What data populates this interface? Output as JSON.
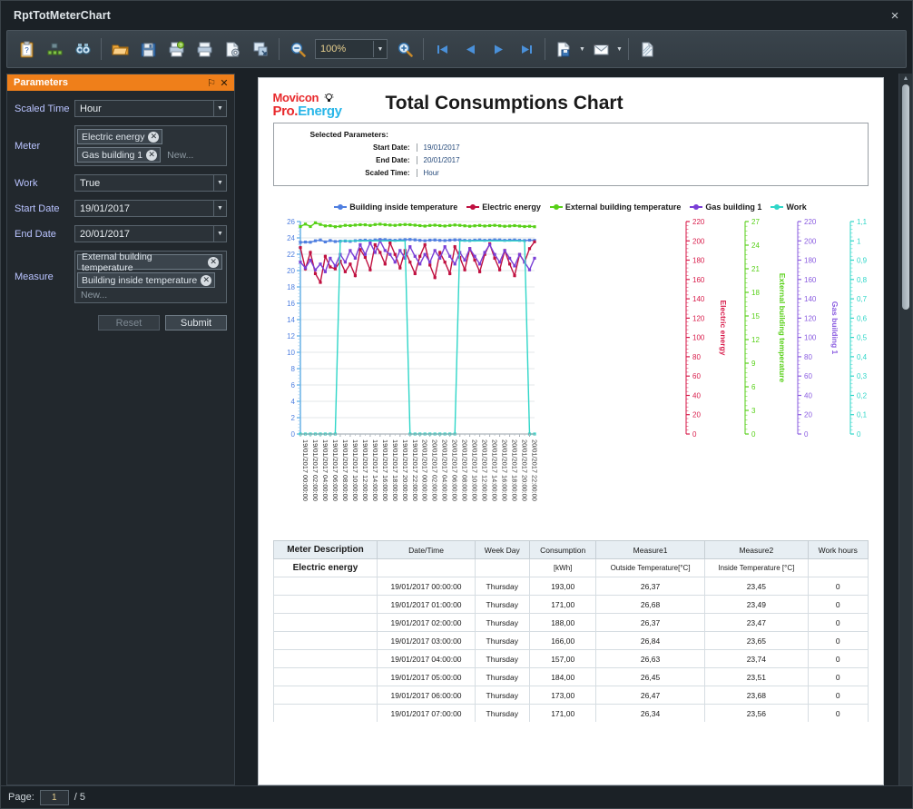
{
  "window": {
    "title": "RptTotMeterChart",
    "close_label": "×"
  },
  "toolbar": {
    "icons": [
      {
        "name": "parameters-icon",
        "label": "Parameters"
      },
      {
        "name": "document-map-icon",
        "label": "Document Map"
      },
      {
        "name": "search-icon",
        "label": "Search"
      },
      {
        "name": "open-icon",
        "label": "Open"
      },
      {
        "name": "save-icon",
        "label": "Save"
      },
      {
        "name": "print-preview-icon",
        "label": "Print Preview"
      },
      {
        "name": "print-icon",
        "label": "Print"
      },
      {
        "name": "page-setup-icon",
        "label": "Page Setup"
      },
      {
        "name": "scale-icon",
        "label": "Scale"
      },
      {
        "name": "zoom-out-icon",
        "label": "Zoom Out"
      },
      {
        "name": "zoom-in-icon",
        "label": "Zoom In"
      },
      {
        "name": "first-page-icon",
        "label": "First Page"
      },
      {
        "name": "previous-page-icon",
        "label": "Previous Page"
      },
      {
        "name": "next-page-icon",
        "label": "Next Page"
      },
      {
        "name": "last-page-icon",
        "label": "Last Page"
      },
      {
        "name": "export-icon",
        "label": "Export Document"
      },
      {
        "name": "email-icon",
        "label": "Send via E-Mail"
      },
      {
        "name": "watermark-icon",
        "label": "Watermark"
      }
    ],
    "zoom_value": "100%"
  },
  "parameters_panel": {
    "title": "Parameters",
    "pin_icon": "⚐",
    "close_icon": "✕",
    "new_placeholder": "New...",
    "fields": [
      {
        "label": "Scaled Time",
        "type": "combo",
        "value": "Hour"
      },
      {
        "label": "Meter",
        "type": "tags",
        "tags": [
          "Electric energy",
          "Gas building 1"
        ]
      },
      {
        "label": "Work",
        "type": "combo",
        "value": "True"
      },
      {
        "label": "Start Date",
        "type": "combo",
        "value": "19/01/2017"
      },
      {
        "label": "End Date",
        "type": "combo",
        "value": "20/01/2017"
      },
      {
        "label": "Measure",
        "type": "tags",
        "tags": [
          "External building temperature",
          "Building inside temperature"
        ]
      }
    ],
    "reset_label": "Reset",
    "submit_label": "Submit"
  },
  "report": {
    "logo": {
      "line1": "Movicon",
      "pro": "Pro.",
      "energy": "Energy"
    },
    "title": "Total Consumptions Chart",
    "selected_parameters_label": "Selected Parameters:",
    "params": [
      {
        "key": "Start Date:",
        "value": "19/01/2017"
      },
      {
        "key": "End Date:",
        "value": "20/01/2017"
      },
      {
        "key": "Scaled Time:",
        "value": "Hour"
      }
    ]
  },
  "chart_data": {
    "type": "line",
    "title": "",
    "xlabel": "",
    "grid": true,
    "legend_position": "top-center",
    "x_tick_labels": [
      "19/01/2017 00:00:00",
      "19/01/2017 02:00:00",
      "19/01/2017 04:00:00",
      "19/01/2017 06:00:00",
      "19/01/2017 08:00:00",
      "19/01/2017 10:00:00",
      "19/01/2017 12:00:00",
      "19/01/2017 14:00:00",
      "19/01/2017 16:00:00",
      "19/01/2017 18:00:00",
      "19/01/2017 20:00:00",
      "19/01/2017 22:00:00",
      "20/01/2017 00:00:00",
      "20/01/2017 02:00:00",
      "20/01/2017 04:00:00",
      "20/01/2017 06:00:00",
      "20/01/2017 08:00:00",
      "20/01/2017 10:00:00",
      "20/01/2017 12:00:00",
      "20/01/2017 14:00:00",
      "20/01/2017 16:00:00",
      "20/01/2017 18:00:00",
      "20/01/2017 20:00:00",
      "20/01/2017 22:00:00"
    ],
    "axes": [
      {
        "name": "Building inside temperature",
        "color": "#4f7fe0",
        "position": "left",
        "min": 0,
        "max": 26,
        "step": 2,
        "ticks": [
          "0",
          "2",
          "4",
          "6",
          "8",
          "10",
          "12",
          "14",
          "16",
          "18",
          "20",
          "22",
          "24",
          "26"
        ]
      },
      {
        "name": "Electric energy",
        "color": "#d81b4a",
        "position": "right",
        "min": 0,
        "max": 220,
        "step": 20,
        "ticks": [
          "0",
          "20",
          "40",
          "60",
          "80",
          "100",
          "120",
          "140",
          "160",
          "180",
          "200",
          "220"
        ]
      },
      {
        "name": "External building temperature",
        "color": "#57d017",
        "position": "right",
        "min": 0,
        "max": 27,
        "step": 3,
        "ticks": [
          "0",
          "3",
          "6",
          "9",
          "12",
          "15",
          "18",
          "21",
          "24",
          "27"
        ]
      },
      {
        "name": "Gas building 1",
        "color": "#8a5ce0",
        "position": "right",
        "min": 0,
        "max": 220,
        "step": 20,
        "ticks": [
          "0",
          "20",
          "40",
          "60",
          "80",
          "100",
          "120",
          "140",
          "160",
          "180",
          "200",
          "220"
        ]
      },
      {
        "name": "Work",
        "color": "#2fd6c8",
        "position": "right",
        "min": 0,
        "max": 1.1,
        "step": 0.1,
        "ticks": [
          "0",
          "0,1",
          "0,2",
          "0,3",
          "0,4",
          "0,5",
          "0,6",
          "0,7",
          "0,8",
          "0,9",
          "1",
          "1,1"
        ]
      }
    ],
    "legend": [
      {
        "name": "Building inside temperature",
        "color": "#4f7fe0"
      },
      {
        "name": "Electric energy",
        "color": "#c01040"
      },
      {
        "name": "External building temperature",
        "color": "#57d017"
      },
      {
        "name": "Gas building 1",
        "color": "#7a3fd6"
      },
      {
        "name": "Work",
        "color": "#2fd6c8"
      }
    ],
    "series": [
      {
        "name": "Building inside temperature",
        "color": "#4f7fe0",
        "axis": "Building inside temperature",
        "values": [
          23.45,
          23.49,
          23.47,
          23.65,
          23.74,
          23.51,
          23.68,
          23.56,
          23.6,
          23.62,
          23.58,
          23.66,
          23.7,
          23.72,
          23.68,
          23.74,
          23.8,
          23.78,
          23.72,
          23.7,
          23.74,
          23.78,
          23.8,
          23.76,
          23.7,
          23.66,
          23.72,
          23.74,
          23.7,
          23.68,
          23.72,
          23.76,
          23.74,
          23.7,
          23.68,
          23.72,
          23.74,
          23.7,
          23.72,
          23.76,
          23.74,
          23.7,
          23.72,
          23.74,
          23.7,
          23.68,
          23.72,
          23.7
        ]
      },
      {
        "name": "Electric energy",
        "color": "#c01040",
        "axis": "Electric energy",
        "values": [
          193,
          171,
          188,
          166,
          157,
          184,
          173,
          171,
          179,
          168,
          176,
          164,
          191,
          183,
          170,
          196,
          188,
          176,
          198,
          186,
          172,
          190,
          178,
          166,
          184,
          196,
          175,
          162,
          188,
          178,
          166,
          194,
          183,
          170,
          192,
          180,
          168,
          186,
          197,
          182,
          170,
          190,
          176,
          164,
          186,
          178,
          192,
          199
        ]
      },
      {
        "name": "External building temperature",
        "color": "#57d017",
        "axis": "External building temperature",
        "values": [
          26.37,
          26.68,
          26.37,
          26.84,
          26.63,
          26.45,
          26.47,
          26.34,
          26.4,
          26.52,
          26.48,
          26.55,
          26.6,
          26.58,
          26.5,
          26.62,
          26.66,
          26.6,
          26.55,
          26.52,
          26.58,
          26.62,
          26.6,
          26.54,
          26.48,
          26.42,
          26.5,
          26.54,
          26.48,
          26.44,
          26.5,
          26.56,
          26.52,
          26.46,
          26.4,
          26.46,
          26.5,
          26.44,
          26.48,
          26.52,
          26.46,
          26.4,
          26.44,
          26.48,
          26.42,
          26.36,
          26.4,
          26.34
        ]
      },
      {
        "name": "Gas building 1",
        "color": "#7a3fd6",
        "axis": "Gas building 1",
        "values": [
          178,
          172,
          180,
          170,
          176,
          168,
          182,
          174,
          186,
          178,
          190,
          182,
          196,
          186,
          198,
          188,
          200,
          190,
          186,
          178,
          190,
          182,
          194,
          184,
          176,
          186,
          178,
          190,
          182,
          194,
          184,
          176,
          188,
          180,
          192,
          184,
          176,
          188,
          196,
          186,
          178,
          190,
          182,
          174,
          186,
          178,
          170,
          182
        ]
      },
      {
        "name": "Work",
        "color": "#2fd6c8",
        "axis": "Work",
        "values": [
          0,
          0,
          0,
          0,
          0,
          0,
          0,
          0,
          1,
          1,
          1,
          1,
          1,
          1,
          1,
          1,
          1,
          1,
          1,
          1,
          1,
          1,
          0,
          0,
          0,
          0,
          0,
          0,
          0,
          0,
          0,
          0,
          1,
          1,
          1,
          1,
          1,
          1,
          1,
          1,
          1,
          1,
          1,
          1,
          1,
          1,
          0,
          0
        ]
      }
    ]
  },
  "table": {
    "headers": [
      "Meter Description",
      "Date/Time",
      "Week Day",
      "Consumption",
      "Measure1",
      "Measure2",
      "Work hours"
    ],
    "subheader": {
      "meter": "Electric energy",
      "datetime": "",
      "weekday": "",
      "consumption": "[kWh]",
      "measure1": "Outside Temperature[°C]",
      "measure2": "Inside Temperature [°C]",
      "workhours": ""
    },
    "rows": [
      {
        "meter": "",
        "datetime": "19/01/2017 00:00:00",
        "weekday": "Thursday",
        "consumption": "193,00",
        "measure1": "26,37",
        "measure2": "23,45",
        "workhours": "0"
      },
      {
        "meter": "",
        "datetime": "19/01/2017 01:00:00",
        "weekday": "Thursday",
        "consumption": "171,00",
        "measure1": "26,68",
        "measure2": "23,49",
        "workhours": "0"
      },
      {
        "meter": "",
        "datetime": "19/01/2017 02:00:00",
        "weekday": "Thursday",
        "consumption": "188,00",
        "measure1": "26,37",
        "measure2": "23,47",
        "workhours": "0"
      },
      {
        "meter": "",
        "datetime": "19/01/2017 03:00:00",
        "weekday": "Thursday",
        "consumption": "166,00",
        "measure1": "26,84",
        "measure2": "23,65",
        "workhours": "0"
      },
      {
        "meter": "",
        "datetime": "19/01/2017 04:00:00",
        "weekday": "Thursday",
        "consumption": "157,00",
        "measure1": "26,63",
        "measure2": "23,74",
        "workhours": "0"
      },
      {
        "meter": "",
        "datetime": "19/01/2017 05:00:00",
        "weekday": "Thursday",
        "consumption": "184,00",
        "measure1": "26,45",
        "measure2": "23,51",
        "workhours": "0"
      },
      {
        "meter": "",
        "datetime": "19/01/2017 06:00:00",
        "weekday": "Thursday",
        "consumption": "173,00",
        "measure1": "26,47",
        "measure2": "23,68",
        "workhours": "0"
      },
      {
        "meter": "",
        "datetime": "19/01/2017 07:00:00",
        "weekday": "Thursday",
        "consumption": "171,00",
        "measure1": "26,34",
        "measure2": "23,56",
        "workhours": "0"
      }
    ]
  },
  "statusbar": {
    "page_label": "Page:",
    "page_value": "1",
    "page_total": "/ 5"
  }
}
